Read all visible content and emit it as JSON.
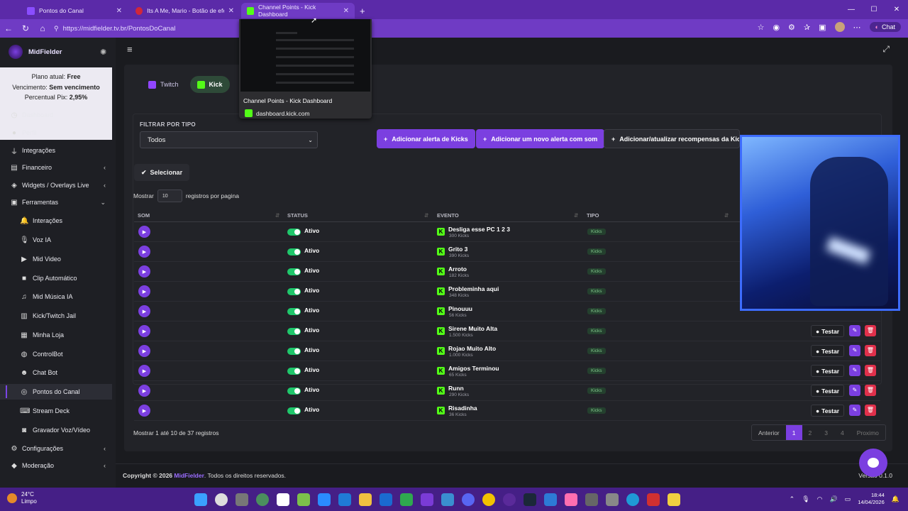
{
  "browser": {
    "tabs": [
      {
        "label": "Pontos do Canal",
        "active": false,
        "color": "#8a4dff"
      },
      {
        "label": "Its A Me, Mario - Botão de efeito",
        "active": false,
        "color": "#d0273a"
      },
      {
        "label": "Channel Points - Kick Dashboard",
        "active": true,
        "color": "#53fc18"
      }
    ],
    "url": "https://midfielder.tv.br/PontosDoCanal",
    "chat_label": "Chat",
    "preview": {
      "title": "Channel Points - Kick Dashboard",
      "domain": "dashboard.kick.com"
    }
  },
  "sidebar": {
    "brand": "MidFielder",
    "plan": {
      "plan_label": "Plano atual:",
      "plan_value": "Free",
      "due_label": "Vencimento:",
      "due_value": "Sem vencimento",
      "pix_label": "Percentual Pix:",
      "pix_value": "2,95%"
    },
    "items": [
      {
        "label": "Dashboard",
        "icon": "gauge-icon"
      },
      {
        "label": "Perfil",
        "icon": "user-icon"
      },
      {
        "label": "Integrações",
        "icon": "plug-icon"
      },
      {
        "label": "Financeiro",
        "icon": "wallet-icon"
      },
      {
        "label": "Widgets / Overlays Live",
        "icon": "layers-icon"
      },
      {
        "label": "Ferramentas",
        "icon": "toolbox-icon"
      },
      {
        "label": "Interações",
        "icon": "bell-icon"
      },
      {
        "label": "Voz IA",
        "icon": "mic-icon"
      },
      {
        "label": "Mid Video",
        "icon": "video-icon"
      },
      {
        "label": "Clip Automático",
        "icon": "clip-icon"
      },
      {
        "label": "Mid Música IA",
        "icon": "music-icon"
      },
      {
        "label": "Kick/Twitch Jail",
        "icon": "jail-icon"
      },
      {
        "label": "Minha Loja",
        "icon": "store-icon"
      },
      {
        "label": "ControlBot",
        "icon": "gamepad-icon"
      },
      {
        "label": "Chat Bot",
        "icon": "robot-icon"
      },
      {
        "label": "Pontos do Canal",
        "icon": "coins-icon"
      },
      {
        "label": "Stream Deck",
        "icon": "keyboard-icon"
      },
      {
        "label": "Gravador Voz/Vídeo",
        "icon": "camera-icon"
      },
      {
        "label": "Configurações",
        "icon": "gear-icon"
      },
      {
        "label": "Moderação",
        "icon": "shield-icon"
      }
    ]
  },
  "main": {
    "platform_tabs": [
      {
        "label": "Twitch",
        "color": "#9146ff"
      },
      {
        "label": "Kick",
        "color": "#53fc18"
      }
    ],
    "filter_label": "FILTRAR POR TIPO",
    "filter_value": "Todos",
    "buttons": {
      "add_kicks": "Adicionar alerta de Kicks",
      "add_sound": "Adicionar um novo alerta com som",
      "add_rewards": "Adicionar/atualizar recompensas da Kick"
    },
    "select_label": "Selecionar",
    "length": {
      "prefix": "Mostrar",
      "value": "10",
      "suffix": "registros por pagina"
    },
    "columns": [
      "SOM",
      "STATUS",
      "EVENTO",
      "TIPO"
    ],
    "rows": [
      {
        "status": "Ativo",
        "event": "Desliga esse PC 1 2 3",
        "cost": "300 Kicks",
        "type": "Kicks"
      },
      {
        "status": "Ativo",
        "event": "Grito 3",
        "cost": "390 Kicks",
        "type": "Kicks"
      },
      {
        "status": "Ativo",
        "event": "Arroto",
        "cost": "182 Kicks",
        "type": "Kicks"
      },
      {
        "status": "Ativo",
        "event": "Probleminha aqui",
        "cost": "348 Kicks",
        "type": "Kicks"
      },
      {
        "status": "Ativo",
        "event": "Pinouuu",
        "cost": "56 Kicks",
        "type": "Kicks"
      },
      {
        "status": "Ativo",
        "event": "Sirene Muito Alta",
        "cost": "1.500 Kicks",
        "type": "Kicks"
      },
      {
        "status": "Ativo",
        "event": "Rojao Muito Alto",
        "cost": "1.000 Kicks",
        "type": "Kicks"
      },
      {
        "status": "Ativo",
        "event": "Amigos Terminou",
        "cost": "65 Kicks",
        "type": "Kicks"
      },
      {
        "status": "Ativo",
        "event": "Runn",
        "cost": "290 Kicks",
        "type": "Kicks"
      },
      {
        "status": "Ativo",
        "event": "Risadinha",
        "cost": "36 Kicks",
        "type": "Kicks"
      }
    ],
    "test_label": "Testar",
    "info": "Mostrar 1 até 10 de 37 registros",
    "pager": [
      "Anterior",
      "1",
      "2",
      "3",
      "4",
      "Proximo"
    ]
  },
  "footer": {
    "copy_prefix": "Copyright © 2026",
    "brand": "MidFielder",
    "copy_suffix": ". Todos os direitos reservados.",
    "version": "Versão 0.1.0"
  },
  "taskbar": {
    "temp": "24°C",
    "condition": "Limpo",
    "time": "18:44",
    "date": "14/04/2026"
  }
}
